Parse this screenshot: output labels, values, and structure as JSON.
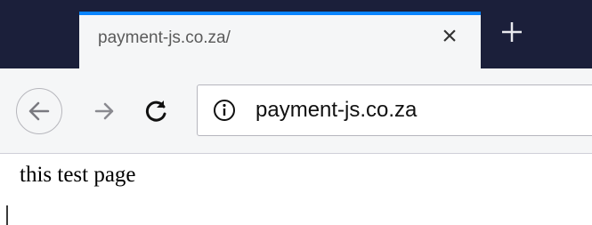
{
  "tab": {
    "title": "payment-js.co.za/",
    "close_icon": "close-icon"
  },
  "new_tab_icon": "plus-icon",
  "nav": {
    "back_icon": "arrow-left-icon",
    "forward_icon": "arrow-right-icon",
    "reload_icon": "reload-icon"
  },
  "urlbar": {
    "info_icon": "info-icon",
    "url": "payment-js.co.za"
  },
  "page": {
    "text": "this test page"
  },
  "colors": {
    "tabstrip": "#1b1f3a",
    "tab_accent": "#0a84ff",
    "toolbar": "#f5f6f7"
  }
}
